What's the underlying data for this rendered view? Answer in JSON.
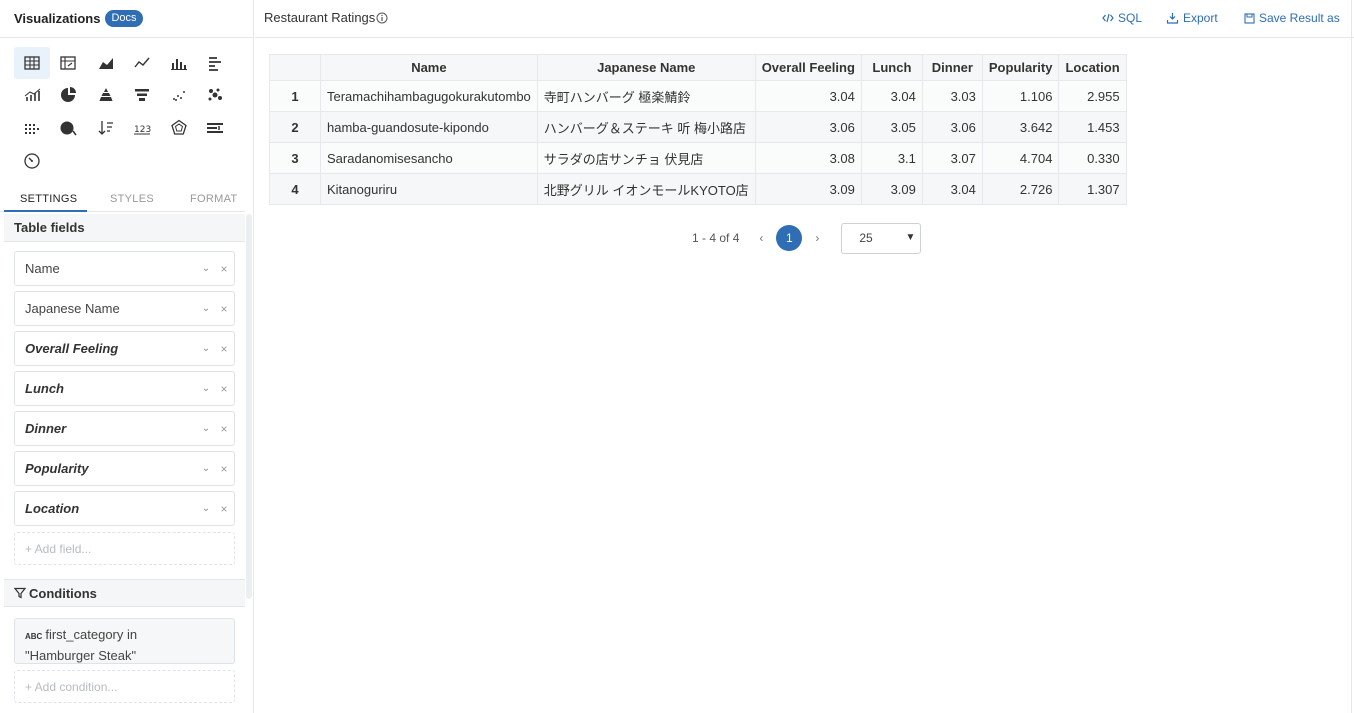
{
  "sidebar": {
    "title": "Visualizations",
    "docs_badge": "Docs",
    "viz_icons": [
      "table-icon",
      "pivot-table-icon",
      "area-chart-icon",
      "line-chart-icon",
      "bar-chart-icon",
      "horizontal-bar-icon",
      "combo-chart-icon",
      "pie-chart-icon",
      "pyramid-icon",
      "funnel-icon",
      "scatter-icon",
      "bubble-icon",
      "heatmap-icon",
      "geo-map-icon",
      "sort-icon",
      "number-metric-icon",
      "radar-icon",
      "bullet-icon",
      "gauge-icon"
    ],
    "tabs": [
      "SETTINGS",
      "STYLES",
      "FORMAT"
    ],
    "active_tab": "SETTINGS",
    "table_fields_title": "Table fields",
    "fields": [
      {
        "label": "Name",
        "measure": false
      },
      {
        "label": "Japanese Name",
        "measure": false
      },
      {
        "label": "Overall Feeling",
        "measure": true
      },
      {
        "label": "Lunch",
        "measure": true
      },
      {
        "label": "Dinner",
        "measure": true
      },
      {
        "label": "Popularity",
        "measure": true
      },
      {
        "label": "Location",
        "measure": true
      }
    ],
    "add_field": "+ Add field...",
    "conditions_title": "Conditions",
    "condition": {
      "type_badge": "ABC",
      "line1": "first_category in",
      "line2": "\"Hamburger Steak\""
    },
    "add_condition": "+ Add condition..."
  },
  "header": {
    "report_title": "Restaurant Ratings",
    "sql_label": "SQL",
    "export_label": "Export",
    "save_label": "Save Result as"
  },
  "table": {
    "columns": [
      "",
      "Name",
      "Japanese Name",
      "Overall Feeling",
      "Lunch",
      "Dinner",
      "Popularity",
      "Location"
    ],
    "rows": [
      [
        "1",
        "Teramachihambagugokurakutombo",
        "寺町ハンバーグ 極楽鯖鈴",
        "3.04",
        "3.04",
        "3.03",
        "1.106",
        "2.955"
      ],
      [
        "2",
        "hamba-guandosute-kipondo",
        "ハンバーグ＆ステーキ 听 梅小路店",
        "3.06",
        "3.05",
        "3.06",
        "3.642",
        "1.453"
      ],
      [
        "3",
        "Saradanomisesancho",
        "サラダの店サンチョ 伏見店",
        "3.08",
        "3.1",
        "3.07",
        "4.704",
        "0.330"
      ],
      [
        "4",
        "Kitanoguriru",
        "北野グリル イオンモールKYOTO店",
        "3.09",
        "3.09",
        "3.04",
        "2.726",
        "1.307"
      ]
    ]
  },
  "pagination": {
    "info": "1 - 4 of 4",
    "prev": "‹",
    "current": "1",
    "next": "›",
    "page_size": "25"
  },
  "colors": {
    "accent": "#2f6db5",
    "border": "#e3e6ea"
  }
}
